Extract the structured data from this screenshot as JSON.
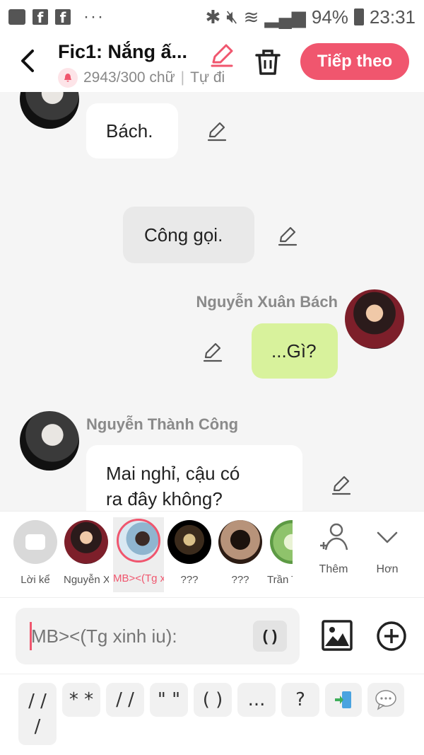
{
  "status_bar": {
    "battery": "94%",
    "time": "23:31"
  },
  "header": {
    "title": "Fic1: Nắng ấ...",
    "word_count": "2943/300 chữ",
    "mode": "Tự đi",
    "next_label": "Tiếp theo"
  },
  "messages": [
    {
      "side": "left",
      "speaker": "",
      "text": "Bách."
    },
    {
      "side": "center",
      "speaker": "",
      "text": "Công gọi."
    },
    {
      "side": "right",
      "speaker": "Nguyễn Xuân Bách",
      "text": "...Gì?"
    },
    {
      "side": "left",
      "speaker": "Nguyễn Thành Công",
      "text_line1": "Mai nghỉ, cậu có",
      "text_line2": "ra đây không?"
    }
  ],
  "characters": [
    {
      "name": "Lời kể"
    },
    {
      "name": "Nguyễn X..."
    },
    {
      "name": "MB><(Tg x..."
    },
    {
      "name": "???"
    },
    {
      "name": "???"
    },
    {
      "name": "Trần T"
    }
  ],
  "actions": {
    "add_label": "Thêm",
    "more_label": "Hơn"
  },
  "input": {
    "placeholder": "MB><(Tg xinh iu):",
    "paren_label": "( )"
  },
  "quick_keys": [
    "/ / /",
    "* *",
    "/ /",
    "\" \"",
    "( )",
    "...",
    "?"
  ],
  "colors": {
    "accent": "#f0566e",
    "green_bubble": "#d8f29c"
  }
}
